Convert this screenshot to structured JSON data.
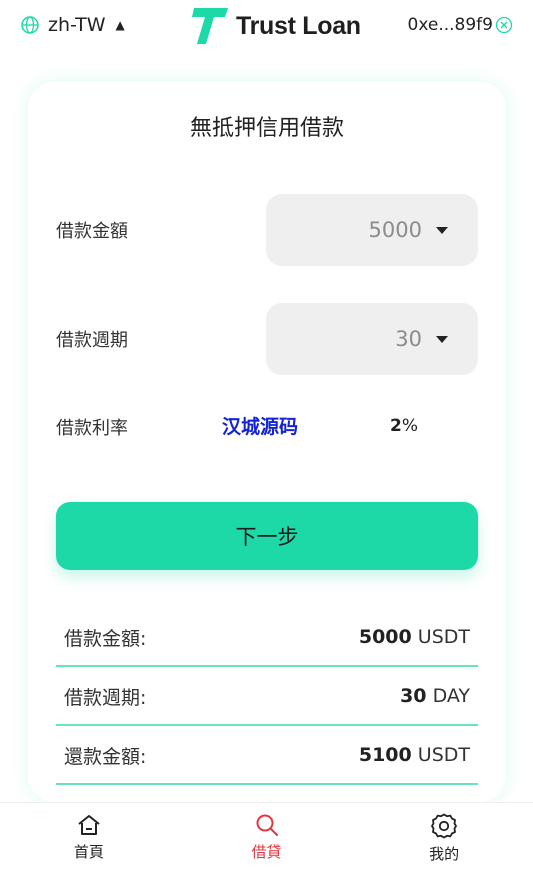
{
  "header": {
    "language": "zh-TW",
    "logo_text": "Trust Loan",
    "wallet_address": "0xe...89f9"
  },
  "colors": {
    "accent": "#1dd9a8",
    "active_tab": "#e8343f",
    "watermark": "#1423d6"
  },
  "loan_form": {
    "title": "無抵押信用借款",
    "amount_label": "借款金額",
    "amount_value": "5000",
    "period_label": "借款週期",
    "period_value": "30",
    "rate_label": "借款利率",
    "rate_value": "2",
    "rate_unit": "%",
    "watermark_text": "汉城源码",
    "next_button": "下一步"
  },
  "summary": [
    {
      "label": "借款金額:",
      "value": "5000",
      "unit": "USDT"
    },
    {
      "label": "借款週期:",
      "value": "30",
      "unit": "DAY"
    },
    {
      "label": "還款金額:",
      "value": "5100",
      "unit": "USDT"
    }
  ],
  "bottom_nav": [
    {
      "label": "首頁",
      "icon": "home-icon"
    },
    {
      "label": "借貸",
      "icon": "search-icon",
      "active": true
    },
    {
      "label": "我的",
      "icon": "gear-icon"
    }
  ]
}
